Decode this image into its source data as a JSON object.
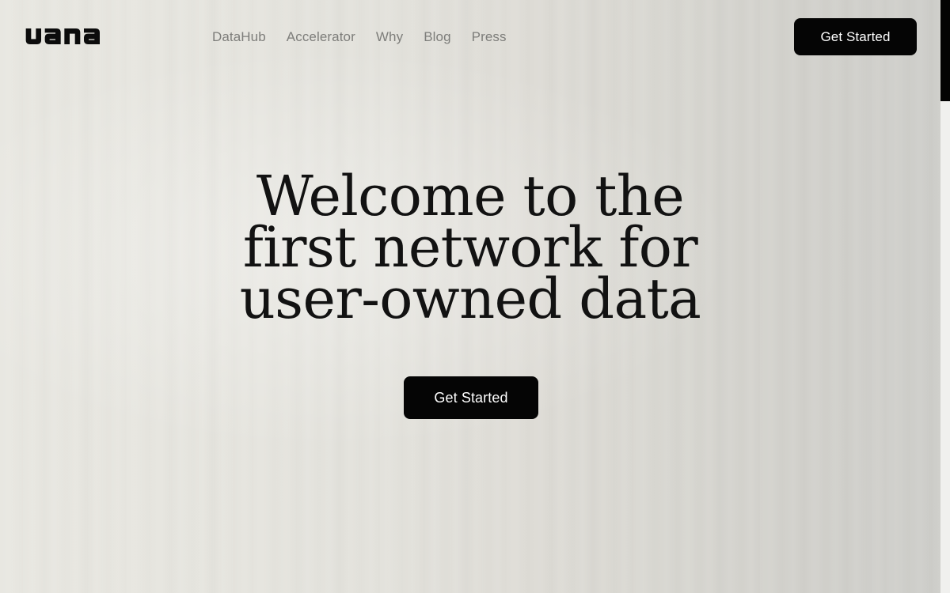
{
  "header": {
    "logo": {
      "name": "vana-logo",
      "text": "vana"
    },
    "nav": {
      "items": [
        {
          "label": "DataHub",
          "name": "nav-link-datahub"
        },
        {
          "label": "Accelerator",
          "name": "nav-link-accelerator"
        },
        {
          "label": "Why",
          "name": "nav-link-why"
        },
        {
          "label": "Blog",
          "name": "nav-link-blog"
        },
        {
          "label": "Press",
          "name": "nav-link-press"
        }
      ]
    },
    "cta": {
      "label": "Get Started"
    }
  },
  "hero": {
    "title_lines": [
      "Welcome to the",
      "first network for",
      "user-owned data"
    ],
    "title_full": "Welcome to the first network for user-owned data",
    "cta": {
      "label": "Get Started"
    }
  },
  "scrollbar": {
    "name": "vertical-scrollbar",
    "thumb_top": 0,
    "thumb_height": 128,
    "track_height": 750
  },
  "colors": {
    "background_left": "#e8e7e1",
    "background_right": "#cececa",
    "accent_dark": "#050505",
    "nav_text": "#7d7d7a",
    "heading_text": "#121212",
    "button_text": "#ffffff",
    "scrollbar_track": "#f0f0ee",
    "scrollbar_thumb": "#030303"
  }
}
